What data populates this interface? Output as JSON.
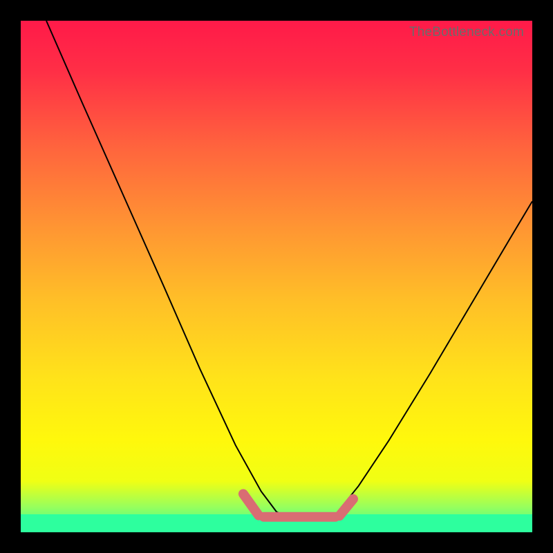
{
  "watermark": "TheBottleneck.com",
  "gradient_stops": [
    {
      "offset": 0.0,
      "color": "#ff1a49"
    },
    {
      "offset": 0.1,
      "color": "#ff2f46"
    },
    {
      "offset": 0.25,
      "color": "#ff653d"
    },
    {
      "offset": 0.4,
      "color": "#ff9433"
    },
    {
      "offset": 0.55,
      "color": "#ffc027"
    },
    {
      "offset": 0.7,
      "color": "#ffe31a"
    },
    {
      "offset": 0.82,
      "color": "#fff80c"
    },
    {
      "offset": 0.9,
      "color": "#f0ff14"
    },
    {
      "offset": 0.95,
      "color": "#98ff5c"
    },
    {
      "offset": 1.0,
      "color": "#2dff9e"
    }
  ],
  "bottom_band": {
    "top_frac": 0.965,
    "height_frac": 0.035,
    "color": "#2dff9e"
  },
  "pink_markers": {
    "color": "#d96d73",
    "stroke_width": 14,
    "segments": [
      {
        "x1_frac": 0.435,
        "y1_frac": 0.925,
        "x2_frac": 0.465,
        "y2_frac": 0.967
      },
      {
        "x1_frac": 0.475,
        "y1_frac": 0.97,
        "x2_frac": 0.615,
        "y2_frac": 0.97
      },
      {
        "x1_frac": 0.623,
        "y1_frac": 0.968,
        "x2_frac": 0.65,
        "y2_frac": 0.935
      }
    ]
  },
  "chart_data": {
    "type": "line",
    "title": "",
    "xlabel": "",
    "ylabel": "",
    "xlim": [
      0,
      1
    ],
    "ylim": [
      0,
      1
    ],
    "note": "Axes are unlabeled in the source image; coordinates are normalized to the plot area (0=left/top edge of gradient, 1=right/bottom). y increases downward as drawn.",
    "series": [
      {
        "name": "left-branch",
        "x": [
          0.05,
          0.12,
          0.2,
          0.28,
          0.35,
          0.42,
          0.47,
          0.5,
          0.53
        ],
        "y": [
          0.0,
          0.16,
          0.34,
          0.52,
          0.68,
          0.83,
          0.92,
          0.96,
          0.975
        ]
      },
      {
        "name": "valley-floor",
        "x": [
          0.53,
          0.56,
          0.59,
          0.61
        ],
        "y": [
          0.975,
          0.976,
          0.975,
          0.972
        ]
      },
      {
        "name": "right-branch",
        "x": [
          0.61,
          0.66,
          0.72,
          0.8,
          0.88,
          0.96,
          1.0
        ],
        "y": [
          0.972,
          0.91,
          0.82,
          0.69,
          0.555,
          0.42,
          0.353
        ]
      }
    ],
    "highlight": {
      "description": "Thick pink segment along the valley floor marking the optimal range",
      "x_range_frac": [
        0.44,
        0.65
      ]
    }
  }
}
